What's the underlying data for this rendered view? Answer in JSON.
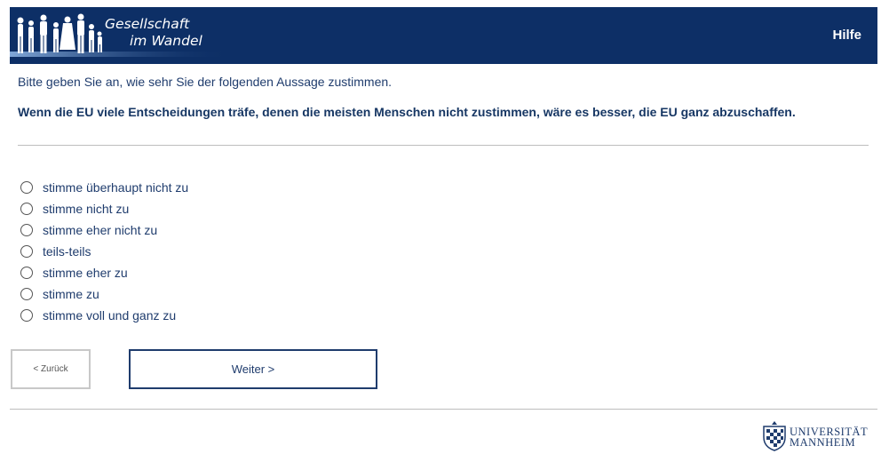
{
  "header": {
    "logo_line1": "Gesellschaft",
    "logo_line2": "im Wandel",
    "help_label": "Hilfe",
    "background_color": "#0d2f66"
  },
  "instruction": "Bitte geben Sie an, wie sehr Sie der folgenden Aussage zustimmen.",
  "question": "Wenn die EU viele Entscheidungen träfe, denen die meisten Menschen nicht zustimmen, wäre es besser, die EU ganz abzuschaffen.",
  "options": [
    "stimme überhaupt nicht zu",
    "stimme nicht zu",
    "stimme eher nicht zu",
    "teils-teils",
    "stimme eher zu",
    "stimme zu",
    "stimme voll und ganz zu"
  ],
  "navigation": {
    "back_label": "< Zurück",
    "next_label": "Weiter >"
  },
  "footer": {
    "university_line1": "UNIVERSITÄT",
    "university_line2": "MANNHEIM",
    "crest_icon": "university-crest-icon"
  }
}
